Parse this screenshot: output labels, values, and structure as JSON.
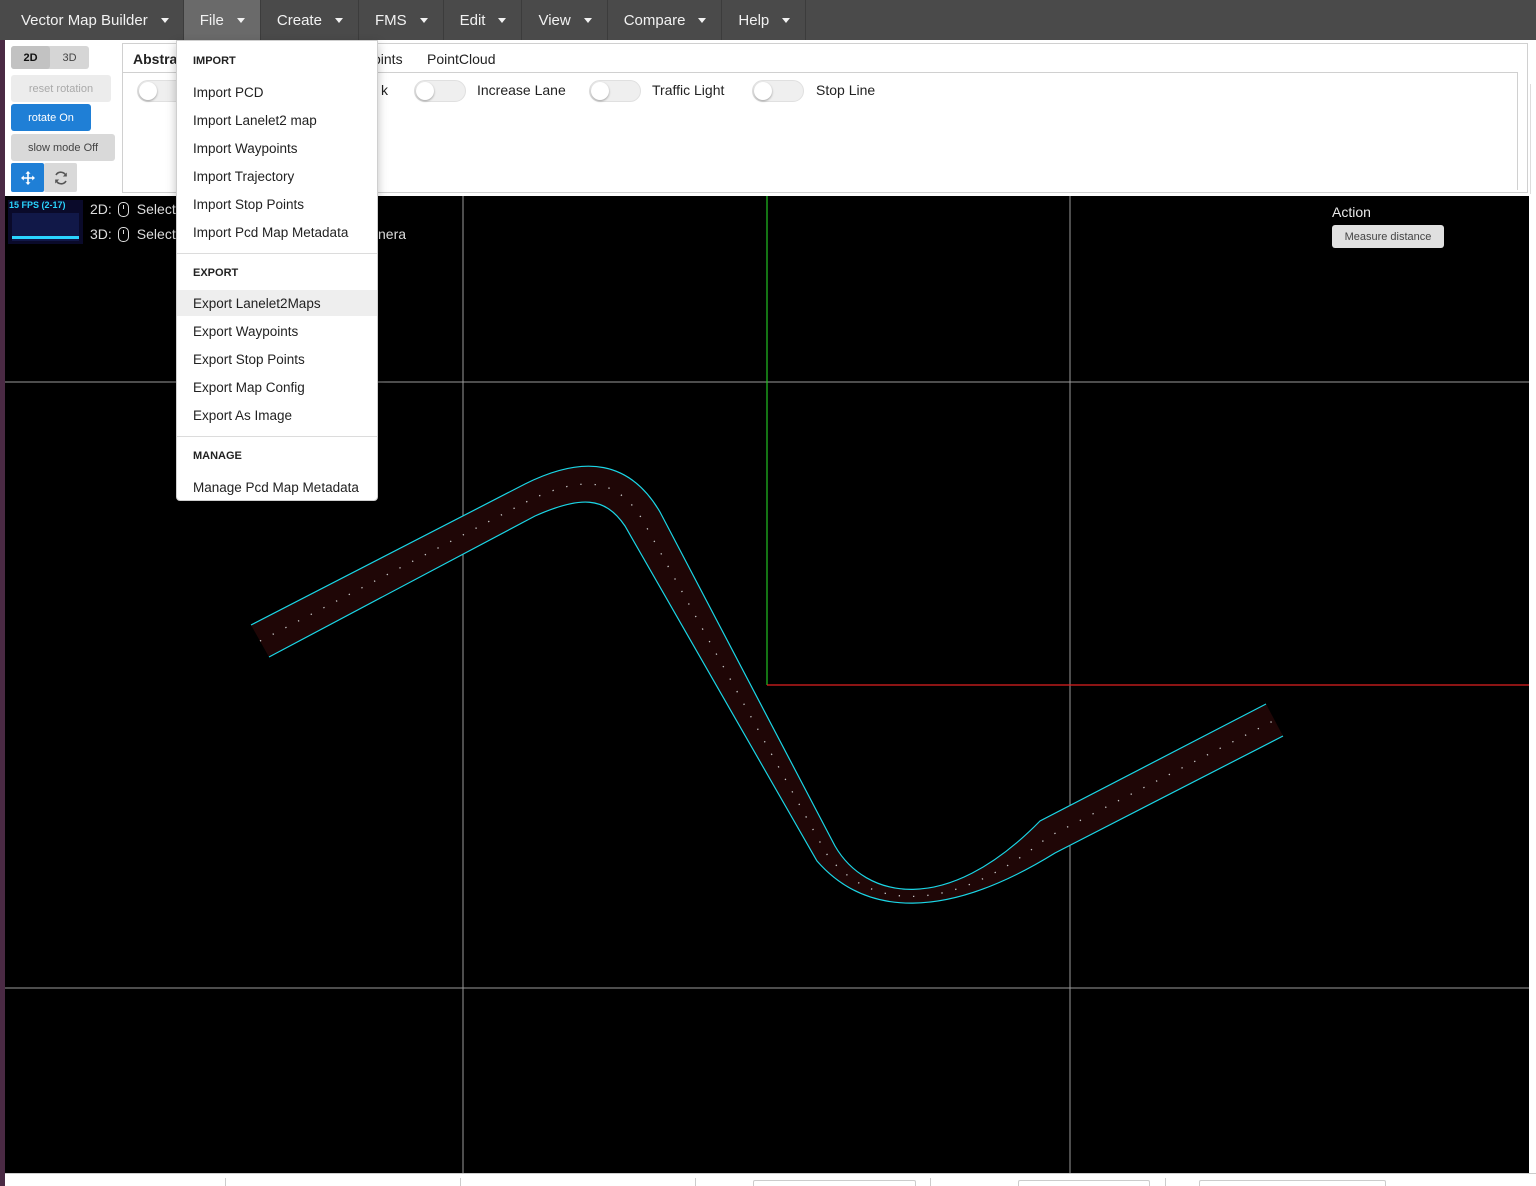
{
  "menubar": {
    "brand": "Vector Map Builder",
    "items": [
      "File",
      "Create",
      "FMS",
      "Edit",
      "View",
      "Compare",
      "Help"
    ],
    "active": "File"
  },
  "toolbar": {
    "mode_2d": "2D",
    "mode_3d": "3D",
    "reset_rotation": "reset rotation",
    "rotate": "rotate On",
    "slow_mode": "slow mode Off",
    "move_icon": "move-arrows-icon",
    "refresh_icon": "refresh-icon"
  },
  "tabs": {
    "items": [
      "Abstra",
      "oints",
      "PointCloud"
    ]
  },
  "toggles": [
    {
      "label": "",
      "on": false
    },
    {
      "label": "k",
      "on": false
    },
    {
      "label": "Increase Lane",
      "on": false
    },
    {
      "label": "Traffic Light",
      "on": false
    },
    {
      "label": "Stop Line",
      "on": false
    }
  ],
  "canvas": {
    "fps": "15 FPS (2-17)",
    "hint_2d_prefix": "2D:",
    "hint_2d": "Select",
    "hint_3d_prefix": "3D:",
    "hint_3d": "Select",
    "hint_3d_suffix": "nera",
    "action_title": "Action",
    "measure_button": "Measure distance",
    "colors": {
      "background": "#000000",
      "grid": "#9a9a9a",
      "lane_edge": "#1ad6e6",
      "lane_fill": "#1f0606",
      "axis_x": "#e02020",
      "axis_y": "#22c022",
      "centerline_dots": "#c8c8c8"
    }
  },
  "file_menu": {
    "import_header": "IMPORT",
    "import_items": [
      "Import PCD",
      "Import Lanelet2 map",
      "Import Waypoints",
      "Import Trajectory",
      "Import Stop Points",
      "Import Pcd Map Metadata"
    ],
    "export_header": "EXPORT",
    "export_items": [
      "Export Lanelet2Maps",
      "Export Waypoints",
      "Export Stop Points",
      "Export Map Config",
      "Export As Image"
    ],
    "manage_header": "MANAGE",
    "manage_items": [
      "Manage Pcd Map Metadata"
    ],
    "hovered_item": "Export Lanelet2Maps"
  }
}
